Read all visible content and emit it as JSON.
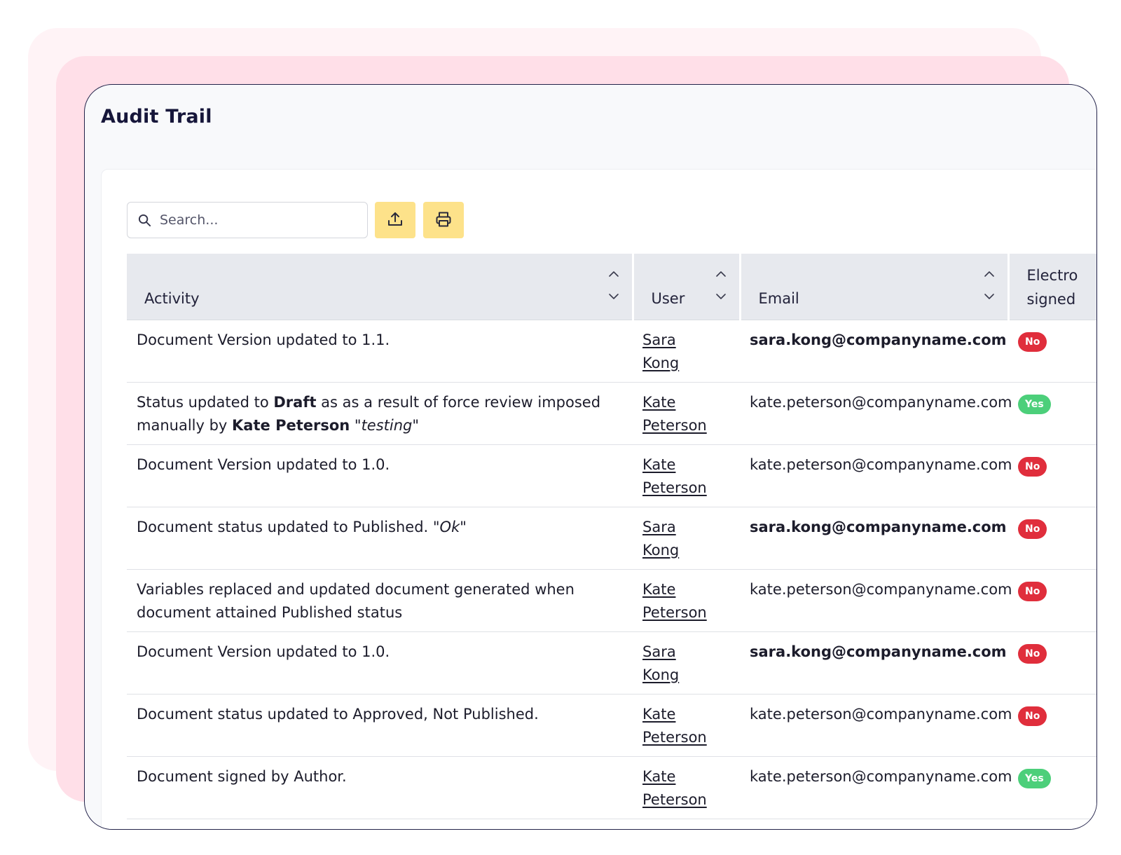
{
  "page": {
    "title": "Audit Trail"
  },
  "toolbar": {
    "search_placeholder": "Search...",
    "export_icon": "upload-icon",
    "print_icon": "printer-icon",
    "button_color": "#fde28a"
  },
  "table": {
    "columns": [
      {
        "label": "Activity"
      },
      {
        "label": "User"
      },
      {
        "label": "Email"
      },
      {
        "label_line1": "Electro",
        "label_line2": "signed"
      }
    ],
    "rows": [
      {
        "activity": [
          {
            "t": "Document Version updated to 1.1."
          }
        ],
        "user": "Sara\nKong",
        "email": "sara.kong@companyname.com",
        "email_bold": true,
        "esig": "No"
      },
      {
        "activity": [
          {
            "t": "Status updated to "
          },
          {
            "t": "Draft",
            "b": true
          },
          {
            "t": " as as a result of force review imposed manually by "
          },
          {
            "t": "Kate Peterson",
            "b": true
          },
          {
            "t": " "
          },
          {
            "t": "\"testing\"",
            "i": true
          }
        ],
        "user": "Kate\nPeterson",
        "email": "kate.peterson@companyname.com",
        "email_bold": false,
        "esig": "Yes"
      },
      {
        "activity": [
          {
            "t": "Document Version updated to 1.0."
          }
        ],
        "user": "Kate\nPeterson",
        "email": "kate.peterson@companyname.com",
        "email_bold": false,
        "esig": "No"
      },
      {
        "activity": [
          {
            "t": "Document status updated to Published. "
          },
          {
            "t": "\"Ok\"",
            "i": true
          }
        ],
        "user": "Sara\nKong",
        "email": "sara.kong@companyname.com",
        "email_bold": true,
        "esig": "No"
      },
      {
        "activity": [
          {
            "t": "Variables replaced and updated document generated when document attained Published status"
          }
        ],
        "user": "Kate\nPeterson",
        "email": "kate.peterson@companyname.com",
        "email_bold": false,
        "esig": "No"
      },
      {
        "activity": [
          {
            "t": "Document Version updated to 1.0."
          }
        ],
        "user": "Sara\nKong",
        "email": "sara.kong@companyname.com",
        "email_bold": true,
        "esig": "No"
      },
      {
        "activity": [
          {
            "t": "Document status updated to Approved, Not Published."
          }
        ],
        "user": "Kate\nPeterson",
        "email": "kate.peterson@companyname.com",
        "email_bold": false,
        "esig": "No"
      },
      {
        "activity": [
          {
            "t": "Document signed by Author."
          }
        ],
        "user": "Kate\nPeterson",
        "email": "kate.peterson@companyname.com",
        "email_bold": false,
        "esig": "Yes"
      }
    ]
  },
  "colors": {
    "badge_no": "#e02e3c",
    "badge_yes": "#4ccf7a",
    "header_bg": "#e7e9ee",
    "stack_back": "#fff3f6",
    "stack_mid": "#ffdfe8"
  }
}
